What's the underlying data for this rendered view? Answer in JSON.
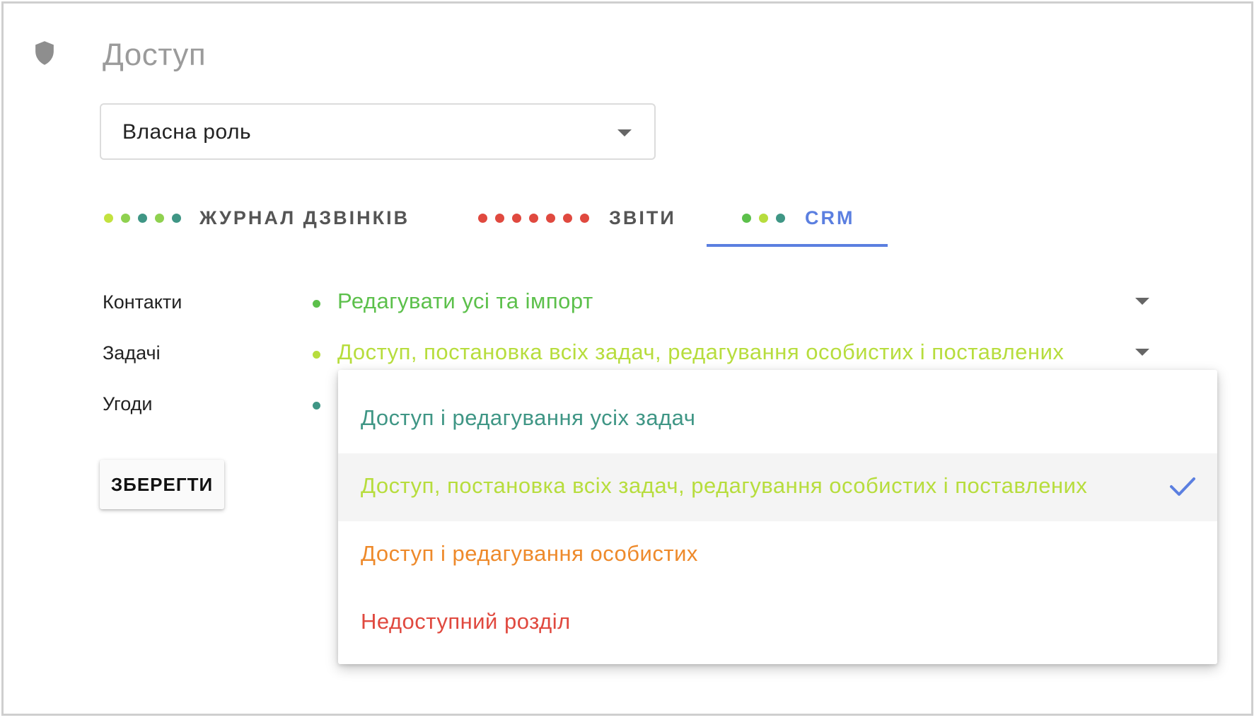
{
  "section": {
    "title": "Доступ",
    "icon": "shield-icon"
  },
  "role_select": {
    "value": "Власна роль"
  },
  "tabs": [
    {
      "label": "ЖУРНАЛ ДЗВІНКІВ",
      "dot_colors": [
        "#c3e23f",
        "#8fd14f",
        "#3f9685",
        "#8fd14f",
        "#3f9685"
      ]
    },
    {
      "label": "ЗВІТИ",
      "dot_colors": [
        "#e0493f",
        "#e0493f",
        "#e0493f",
        "#e0493f",
        "#e0493f",
        "#e0493f",
        "#e0493f"
      ]
    },
    {
      "label": "CRM",
      "active": true,
      "dot_colors": [
        "#5cc04b",
        "#b7dd3d",
        "#3f9685"
      ]
    }
  ],
  "permissions": [
    {
      "label": "Контакти",
      "value": "Редагувати усі та імпорт",
      "color": "#5cc04b"
    },
    {
      "label": "Задачі",
      "value": "Доступ, постановка всіх задач, редагування особистих і поставлених",
      "color": "#b7dd3d"
    },
    {
      "label": "Угоди",
      "value": "",
      "color": "#3f9685"
    }
  ],
  "save_button": {
    "label": "ЗБЕРЕГТИ"
  },
  "dropdown": {
    "options": [
      {
        "label": "Доступ і редагування усіх задач",
        "color": "#3f9685",
        "selected": false
      },
      {
        "label": "Доступ, постановка всіх задач, редагування особистих і поставлених",
        "color": "#b7dd3d",
        "selected": true
      },
      {
        "label": "Доступ і редагування особистих",
        "color": "#ee8a2b",
        "selected": false
      },
      {
        "label": "Недоступний розділ",
        "color": "#e0493f",
        "selected": false
      }
    ],
    "check_color": "#5b7fe0"
  }
}
